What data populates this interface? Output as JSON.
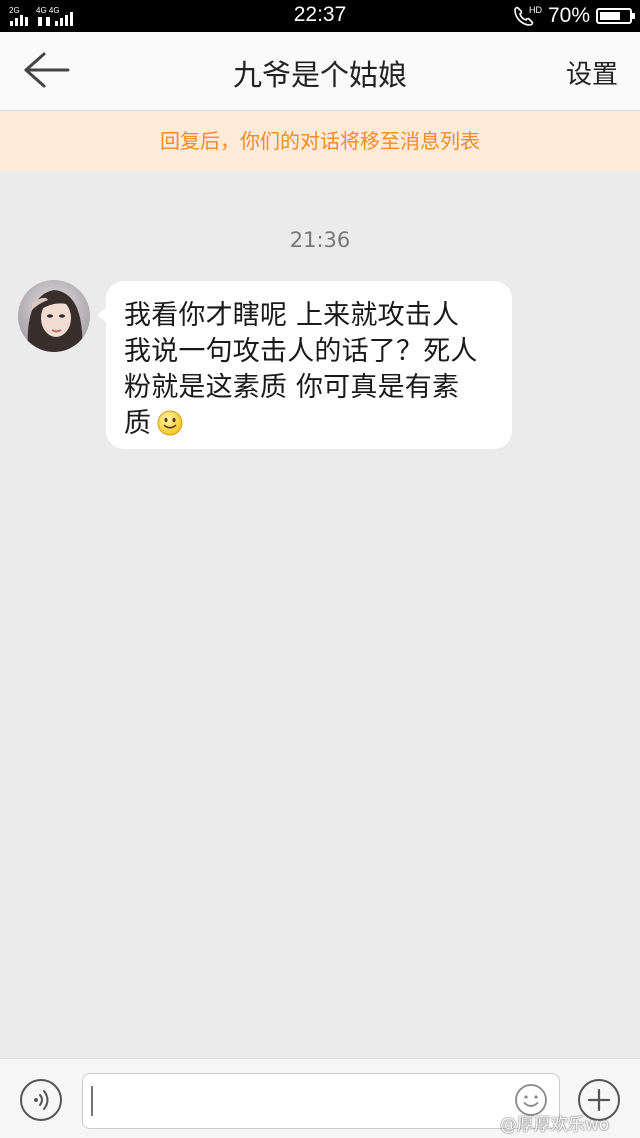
{
  "status_bar": {
    "signal_left": "2G",
    "signal_right": "4G 4G",
    "time": "22:37",
    "hd_label": "HD",
    "battery_text": "70%",
    "battery_level": 0.7
  },
  "header": {
    "title": "九爷是个姑娘",
    "settings_label": "设置"
  },
  "notice": {
    "text": "回复后，你们的对话将移至消息列表"
  },
  "chat": {
    "timestamp": "21:36",
    "message": {
      "lines": [
        "我看你才瞎呢 上来就攻击人",
        "我说一句攻击人的话了？死人",
        "粉就是这素质 你可真是有素",
        "质"
      ],
      "emoji": "smile-emoji"
    }
  },
  "input_bar": {
    "input_value": "",
    "placeholder": ""
  },
  "watermark": {
    "text": "@厚厚欢乐wo"
  },
  "colors": {
    "chat_background": "#ebebeb",
    "notice_background": "#fdebd8",
    "notice_text": "#f08a2a",
    "bubble": "#ffffff"
  }
}
